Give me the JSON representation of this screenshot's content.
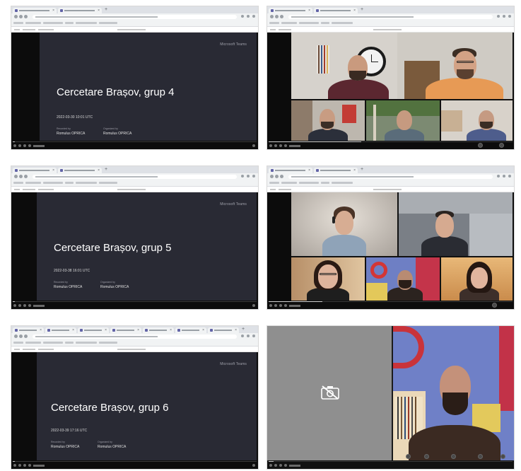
{
  "colors": {
    "teams_slide_bg": "#292a34",
    "player_bg": "#0c0c0c",
    "teams_purple": "#6264a7",
    "camera_off_tile": "#8f8f8f"
  },
  "slides": [
    {
      "brand": "Microsoft Teams",
      "title": "Cercetare Brașov, grup 4",
      "date": "2022-03-30 10:01 UTC",
      "recorded_by_label": "Recorded by",
      "recorded_by": "Romulus OPRICA",
      "organized_by_label": "Organized by",
      "organized_by": "Romulus OPRICA"
    },
    {
      "brand": "Microsoft Teams",
      "title": "Cercetare Brașov, grup 5",
      "date": "2022-03-38 16:01 UTC",
      "recorded_by_label": "Recorded by",
      "recorded_by": "Romulus OPRICA",
      "organized_by_label": "Organized by",
      "organized_by": "Romulus OPRICA"
    },
    {
      "brand": "Microsoft Teams",
      "title": "Cercetare Brașov, grup 6",
      "date": "2022-03-39 17:16 UTC",
      "recorded_by_label": "Recorded by",
      "recorded_by": "Romulus OPRICA",
      "organized_by_label": "Organized by",
      "organized_by": "Romulus OPRICA"
    }
  ],
  "icons": {
    "camera_off": "camera-off-icon",
    "play": "play-icon",
    "volume": "volume-icon",
    "fullscreen": "fullscreen-icon"
  }
}
